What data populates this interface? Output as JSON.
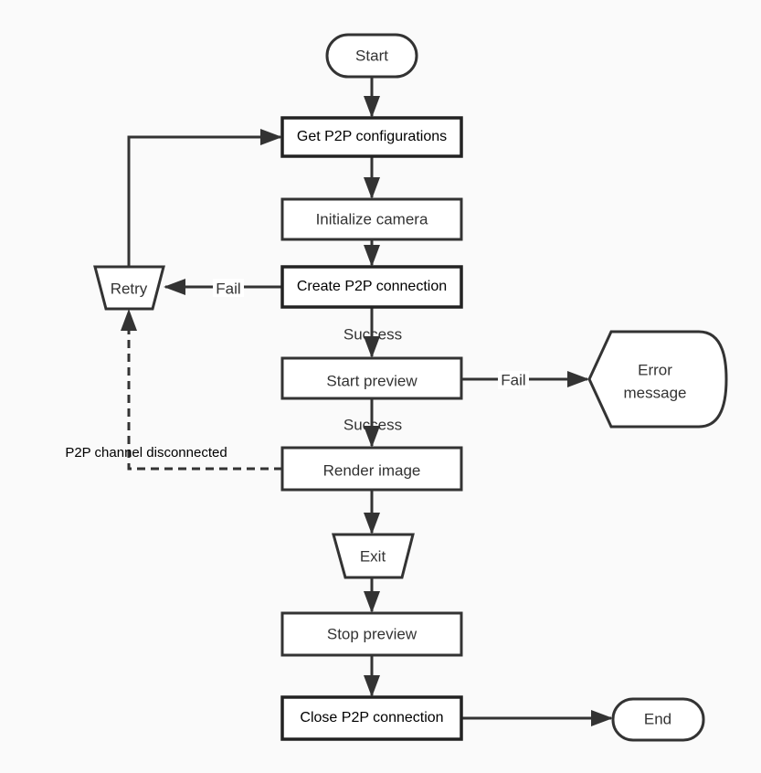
{
  "nodes": {
    "start": "Start",
    "get_config": "Get P2P configurations",
    "init_camera": "Initialize camera",
    "create_conn": "Create P2P connection",
    "start_preview": "Start preview",
    "render_image": "Render image",
    "exit": "Exit",
    "stop_preview": "Stop preview",
    "close_conn": "Close P2P connection",
    "end": "End",
    "retry": "Retry",
    "error_line1": "Error",
    "error_line2": "message"
  },
  "edges": {
    "create_fail": "Fail",
    "create_success": "Success",
    "preview_fail": "Fail",
    "preview_success": "Success",
    "disconnected": "P2P channel disconnected"
  },
  "colors": {
    "background": "#fafafa",
    "stroke": "#333333",
    "fill": "#ffffff"
  }
}
